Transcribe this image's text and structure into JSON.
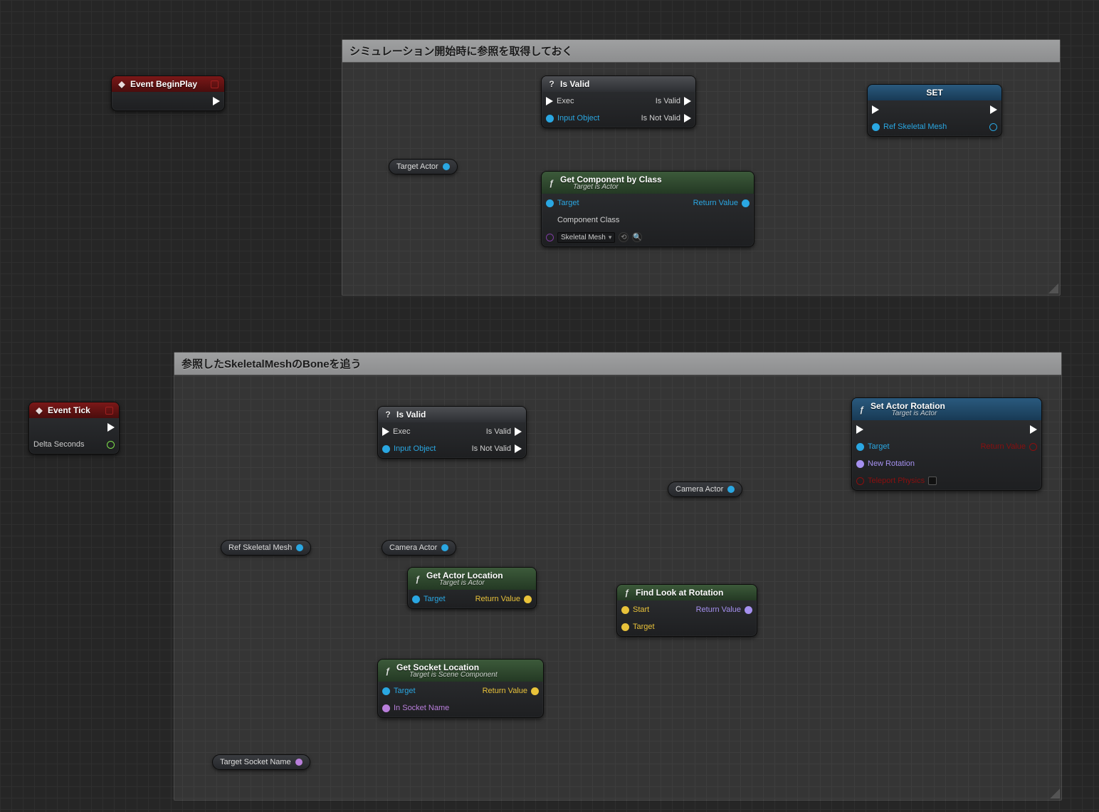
{
  "comments": {
    "c1": {
      "title": "シミュレーション開始時に参照を取得しておく"
    },
    "c2": {
      "title": "参照したSkeletalMeshのBoneを追う"
    }
  },
  "nodes": {
    "eventBeginPlay": {
      "title": "Event BeginPlay"
    },
    "eventTick": {
      "title": "Event Tick",
      "deltaSeconds": "Delta Seconds"
    },
    "isValid1": {
      "title": "Is Valid",
      "exec": "Exec",
      "inputObject": "Input Object",
      "isValid": "Is Valid",
      "isNotValid": "Is Not Valid"
    },
    "isValid2": {
      "title": "Is Valid",
      "exec": "Exec",
      "inputObject": "Input Object",
      "isValid": "Is Valid",
      "isNotValid": "Is Not Valid"
    },
    "getComponentByClass": {
      "title": "Get Component by Class",
      "subtitle": "Target is Actor",
      "target": "Target",
      "componentClass": "Component Class",
      "componentClassValue": "Skeletal Mesh",
      "returnValue": "Return Value"
    },
    "setRefSkeletalMesh": {
      "title": "SET",
      "varName": "Ref Skeletal Mesh"
    },
    "getActorLocation": {
      "title": "Get Actor Location",
      "subtitle": "Target is Actor",
      "target": "Target",
      "returnValue": "Return Value"
    },
    "getSocketLocation": {
      "title": "Get Socket Location",
      "subtitle": "Target is Scene Component",
      "target": "Target",
      "inSocketName": "In Socket Name",
      "returnValue": "Return Value"
    },
    "findLookAtRotation": {
      "title": "Find Look at Rotation",
      "start": "Start",
      "target": "Target",
      "returnValue": "Return Value"
    },
    "setActorRotation": {
      "title": "Set Actor Rotation",
      "subtitle": "Target is Actor",
      "target": "Target",
      "newRotation": "New Rotation",
      "teleportPhysics": "Teleport Physics",
      "returnValue": "Return Value"
    }
  },
  "vars": {
    "targetActor": "Target Actor",
    "refSkeletalMesh": "Ref Skeletal Mesh",
    "cameraActor1": "Camera Actor",
    "cameraActor2": "Camera Actor",
    "targetSocketName": "Target Socket Name"
  }
}
